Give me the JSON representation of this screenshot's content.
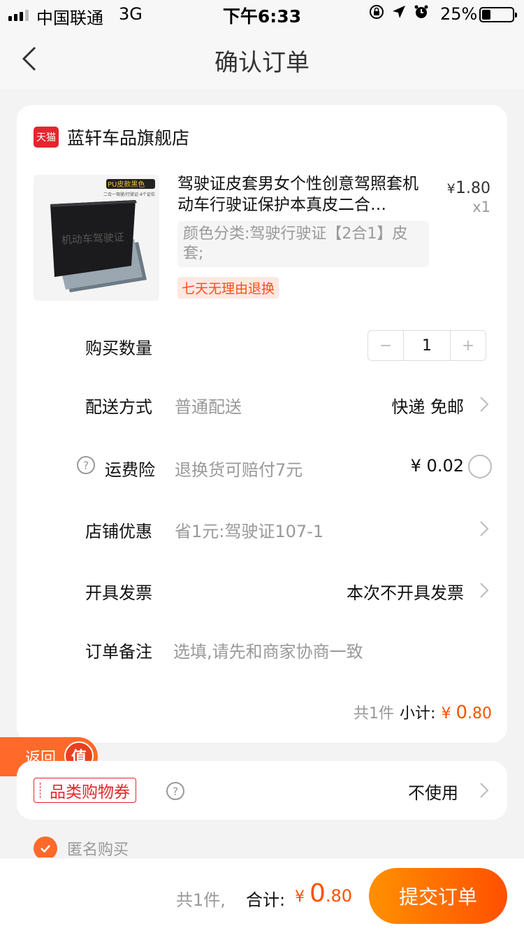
{
  "status_bar": {
    "carrier": "中国联通",
    "network": "3G",
    "time": "下午6:33",
    "battery_pct": "25%",
    "battery_level": 0.25,
    "icons": [
      "orientation-lock-icon",
      "location-arrow-icon",
      "alarm-icon"
    ]
  },
  "nav": {
    "title": "确认订单",
    "back_icon": "chevron-left-icon"
  },
  "shop": {
    "badge": "天猫",
    "name": "蓝轩车品旗舰店"
  },
  "product": {
    "title": "驾驶证皮套男女个性创意驾照套机动车行驶证保护本真皮二合…",
    "price_symbol": "¥",
    "price_int": "1",
    "price_dec": ".80",
    "qty_label": "x1",
    "sku": "颜色分类:驾驶行驶证【2合1】皮套;",
    "return_tag": "七天无理由退换",
    "thumb_badge": "PU皮款黑色",
    "thumb_sub": "二合一驾驶/行驶证:4个证位",
    "thumb_emboss": "机动车驾驶证"
  },
  "rows": {
    "qty": {
      "label": "购买数量",
      "minus": "−",
      "value": "1",
      "plus": "+"
    },
    "delivery": {
      "label": "配送方式",
      "value": "普通配送",
      "right": "快递 免邮"
    },
    "insurance": {
      "label": "运费险",
      "value": "退换货可赔付7元",
      "right": "¥ 0.02",
      "help": "?"
    },
    "discount": {
      "label": "店铺优惠",
      "value": "省1元:驾驶证107-1"
    },
    "invoice": {
      "label": "开具发票",
      "right": "本次不开具发票"
    },
    "note": {
      "label": "订单备注",
      "placeholder": "选填,请先和商家协商一致"
    }
  },
  "subtotal": {
    "count": "共1件",
    "label": "小计:",
    "symbol": "¥",
    "int": "0",
    "dec": ".80"
  },
  "float_back": {
    "label": "返回",
    "badge": "值"
  },
  "voucher": {
    "tag": "品类购物券",
    "help": "?",
    "right": "不使用"
  },
  "anonymous": {
    "label": "匿名购买",
    "checked": true
  },
  "bottom": {
    "count": "共1件,",
    "total_label": "合计:",
    "symbol": "¥",
    "int": "0",
    "dec": ".80",
    "submit": "提交订单"
  },
  "colors": {
    "accent": "#ff5000",
    "tmall_red": "#e4252d",
    "button_start": "#ff9000",
    "button_end": "#ff5000"
  }
}
